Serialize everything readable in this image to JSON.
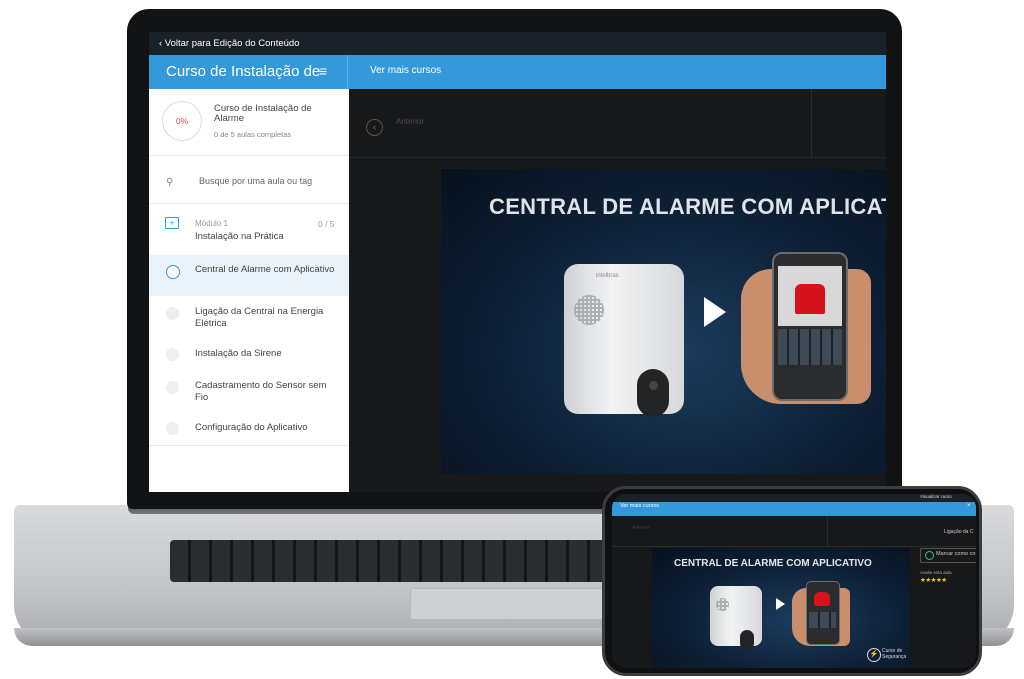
{
  "topbar": {
    "back_label": "‹ Voltar para Edição do Conteúdo"
  },
  "header": {
    "course_title": "Curso de Instalação de",
    "menu_icon": "≡",
    "ver_mais": "Ver mais cursos"
  },
  "sidebar": {
    "progress": "0%",
    "progress_value": 0,
    "title": "Curso de Instalação de Alarme",
    "subtitle": "0 de 5 aulas completas",
    "search_placeholder": "Busque por uma aula ou tag",
    "module_label": "Módulo 1",
    "module_count": "0 / 5",
    "module_name": "Instalação na Prática",
    "lessons": [
      {
        "label": "Central de Alarme com Aplicativo",
        "active": true
      },
      {
        "label": "Ligação da Central na Energia Elétrica",
        "active": false
      },
      {
        "label": "Instalação da Sirene",
        "active": false
      },
      {
        "label": "Cadastramento do Sensor sem Fio",
        "active": false
      },
      {
        "label": "Configuração do Aplicativo",
        "active": false
      }
    ]
  },
  "player": {
    "prev_label": "Anterior",
    "video_title": "CENTRAL DE ALARME COM APLICATIVO",
    "device_brand": "intelbras"
  },
  "mobile": {
    "ver_mais": "Ver mais cursos",
    "visualizar": "Visualizar curso",
    "anterior": "Anterior",
    "next_label": "Ligação da C",
    "video_title": "CENTRAL DE ALARME COM APLICATIVO",
    "mark_label": "Marcar como co",
    "rate_label": "Avalie esta aula",
    "stars": "★★★★★",
    "logo_text": "Curso de Segurança"
  },
  "colors": {
    "accent": "#3499db",
    "dark_bg": "#161718",
    "progress_red": "#e05050"
  }
}
